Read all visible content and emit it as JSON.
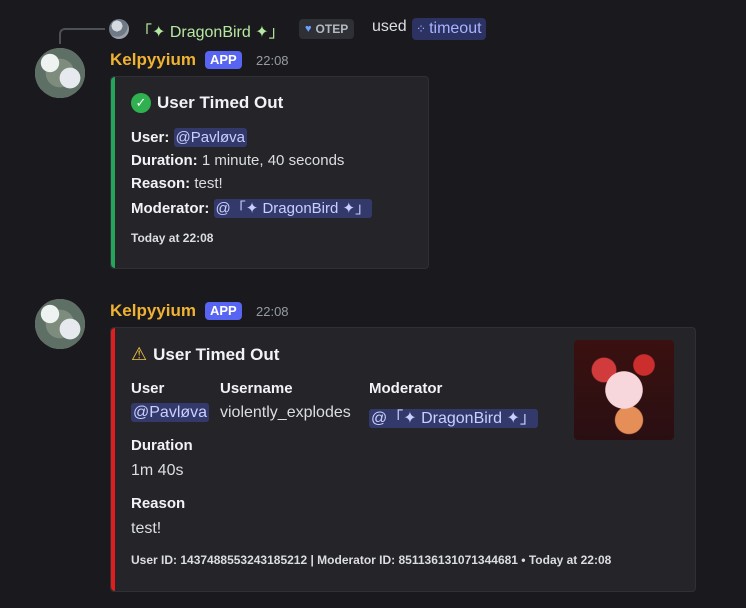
{
  "reply": {
    "name": "「✦ DragonBird ✦」",
    "tag": "OTEP",
    "used_text": "used",
    "command": "timeout"
  },
  "messages": [
    {
      "username": "Kelpyyium",
      "badge": "APP",
      "time": "22:08",
      "embed": {
        "color": "#23a55a",
        "title": "User Timed Out",
        "lines": [
          {
            "label": "User:",
            "value": "@Pavløva"
          },
          {
            "label": "Duration:",
            "value": "1 minute, 40 seconds"
          },
          {
            "label": "Reason:",
            "value": "test!"
          },
          {
            "label": "Moderator:",
            "value": "@「✦ DragonBird ✦」"
          }
        ],
        "footer": "Today at 22:08"
      }
    },
    {
      "username": "Kelpyyium",
      "badge": "APP",
      "time": "22:08",
      "embed": {
        "color": "#e01e1e",
        "title": "User Timed Out",
        "fields": {
          "user": {
            "name": "User",
            "value": "@Pavløva"
          },
          "username": {
            "name": "Username",
            "value": "violently_explodes"
          },
          "moderator": {
            "name": "Moderator",
            "value": "@「✦ DragonBird ✦」"
          },
          "duration": {
            "name": "Duration",
            "value": "1m 40s"
          },
          "reason": {
            "name": "Reason",
            "value": "test!"
          }
        },
        "footer": "User ID: 1437488553243185212 | Moderator ID: 851136131071344681 • Today at 22:08"
      }
    }
  ]
}
